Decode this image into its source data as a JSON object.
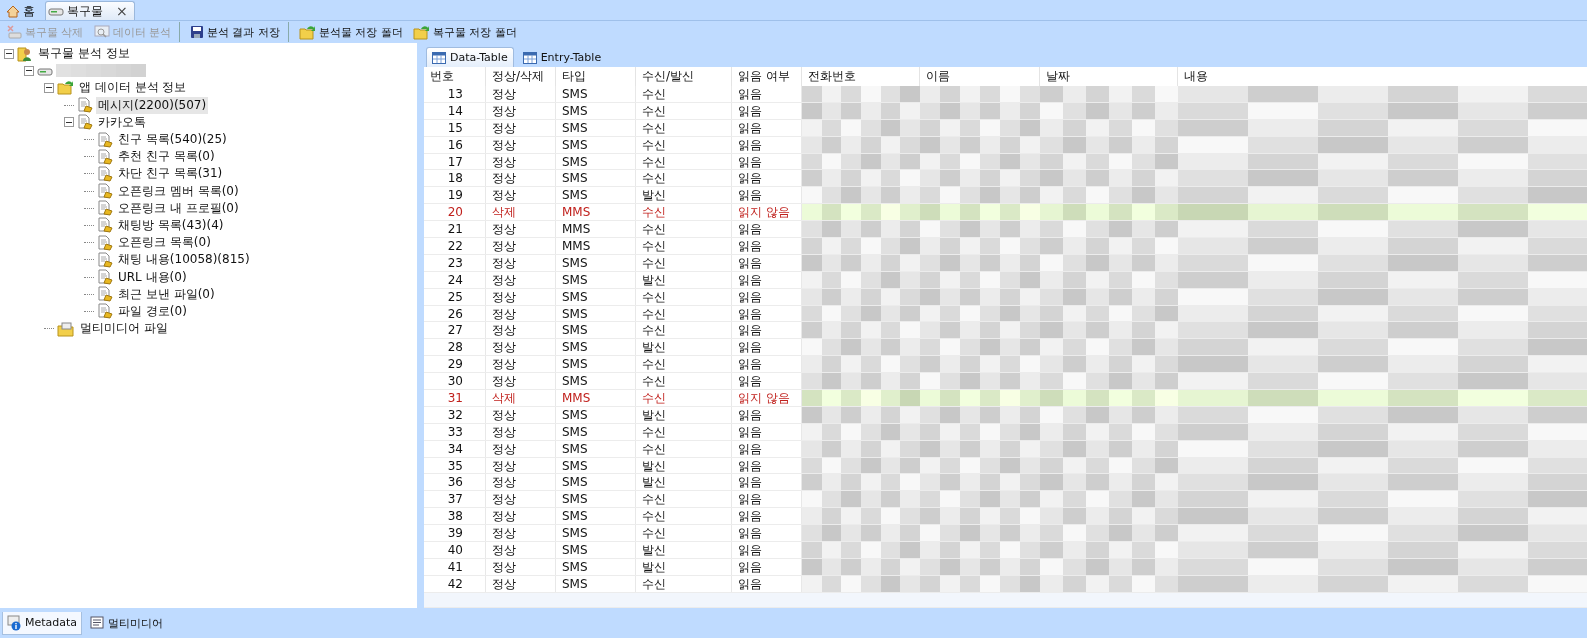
{
  "doc_tabs": [
    {
      "label": "홈",
      "selected": false,
      "closable": false
    },
    {
      "label": "복구물",
      "selected": true,
      "closable": true
    }
  ],
  "close_glyph": "×",
  "toolbar": [
    {
      "label": "복구물 삭제",
      "disabled": true,
      "separator_after": false
    },
    {
      "label": "데이터 분석",
      "disabled": true,
      "separator_after": true
    },
    {
      "label": "분석 결과 저장",
      "disabled": false,
      "separator_after": true
    },
    {
      "label": "분석물 저장 폴더",
      "disabled": false,
      "separator_after": false
    },
    {
      "label": "복구물 저장 폴더",
      "disabled": false,
      "separator_after": false
    }
  ],
  "tree": [
    {
      "label": "복구물 분석 정보",
      "kind": "root",
      "expanded": true,
      "selected": false,
      "children": [
        {
          "kind": "redacted",
          "expanded": true,
          "children": [
            {
              "label": "앱 데이터 분석 정보",
              "kind": "folder",
              "expanded": true,
              "selected": false,
              "children": [
                {
                  "label": "메시지(2200)(507)",
                  "kind": "document",
                  "selected": true
                },
                {
                  "label": "카카오톡",
                  "kind": "document",
                  "expanded": true,
                  "selected": false,
                  "children": [
                    {
                      "label": "친구 목록(540)(25)",
                      "kind": "document",
                      "selected": false
                    },
                    {
                      "label": "추천 친구 목록(0)",
                      "kind": "document",
                      "selected": false
                    },
                    {
                      "label": "차단 친구 목록(31)",
                      "kind": "document",
                      "selected": false
                    },
                    {
                      "label": "오픈링크 멤버 목록(0)",
                      "kind": "document",
                      "selected": false
                    },
                    {
                      "label": "오픈링크 내 프로필(0)",
                      "kind": "document",
                      "selected": false
                    },
                    {
                      "label": "채팅방 목록(43)(4)",
                      "kind": "document",
                      "selected": false
                    },
                    {
                      "label": "오픈링크 목록(0)",
                      "kind": "document",
                      "selected": false
                    },
                    {
                      "label": "채팅 내용(10058)(815)",
                      "kind": "document",
                      "selected": false
                    },
                    {
                      "label": "URL 내용(0)",
                      "kind": "document",
                      "selected": false
                    },
                    {
                      "label": "최근 보낸 파일(0)",
                      "kind": "document",
                      "selected": false
                    },
                    {
                      "label": "파일 경로(0)",
                      "kind": "document",
                      "selected": false
                    }
                  ]
                }
              ]
            },
            {
              "label": "멀티미디어 파일",
              "kind": "media",
              "selected": false
            }
          ]
        }
      ]
    }
  ],
  "table_tabs": [
    {
      "label": "Data-Table",
      "selected": true
    },
    {
      "label": "Entry-Table",
      "selected": false
    }
  ],
  "table": {
    "columns": [
      "번호",
      "정상/삭제",
      "타입",
      "수신/발신",
      "읽음 여부",
      "전화번호",
      "이름",
      "날짜",
      "내용"
    ],
    "rows": [
      {
        "no": "13",
        "status": "정상",
        "type": "SMS",
        "direction": "수신",
        "read": "읽음",
        "deleted": false
      },
      {
        "no": "14",
        "status": "정상",
        "type": "SMS",
        "direction": "수신",
        "read": "읽음",
        "deleted": false
      },
      {
        "no": "15",
        "status": "정상",
        "type": "SMS",
        "direction": "수신",
        "read": "읽음",
        "deleted": false
      },
      {
        "no": "16",
        "status": "정상",
        "type": "SMS",
        "direction": "수신",
        "read": "읽음",
        "deleted": false
      },
      {
        "no": "17",
        "status": "정상",
        "type": "SMS",
        "direction": "수신",
        "read": "읽음",
        "deleted": false
      },
      {
        "no": "18",
        "status": "정상",
        "type": "SMS",
        "direction": "수신",
        "read": "읽음",
        "deleted": false
      },
      {
        "no": "19",
        "status": "정상",
        "type": "SMS",
        "direction": "발신",
        "read": "읽음",
        "deleted": false
      },
      {
        "no": "20",
        "status": "삭제",
        "type": "MMS",
        "direction": "수신",
        "read": "읽지 않음",
        "deleted": true
      },
      {
        "no": "21",
        "status": "정상",
        "type": "MMS",
        "direction": "수신",
        "read": "읽음",
        "deleted": false
      },
      {
        "no": "22",
        "status": "정상",
        "type": "MMS",
        "direction": "수신",
        "read": "읽음",
        "deleted": false
      },
      {
        "no": "23",
        "status": "정상",
        "type": "SMS",
        "direction": "수신",
        "read": "읽음",
        "deleted": false
      },
      {
        "no": "24",
        "status": "정상",
        "type": "SMS",
        "direction": "발신",
        "read": "읽음",
        "deleted": false
      },
      {
        "no": "25",
        "status": "정상",
        "type": "SMS",
        "direction": "수신",
        "read": "읽음",
        "deleted": false
      },
      {
        "no": "26",
        "status": "정상",
        "type": "SMS",
        "direction": "수신",
        "read": "읽음",
        "deleted": false
      },
      {
        "no": "27",
        "status": "정상",
        "type": "SMS",
        "direction": "수신",
        "read": "읽음",
        "deleted": false
      },
      {
        "no": "28",
        "status": "정상",
        "type": "SMS",
        "direction": "발신",
        "read": "읽음",
        "deleted": false
      },
      {
        "no": "29",
        "status": "정상",
        "type": "SMS",
        "direction": "수신",
        "read": "읽음",
        "deleted": false
      },
      {
        "no": "30",
        "status": "정상",
        "type": "SMS",
        "direction": "수신",
        "read": "읽음",
        "deleted": false
      },
      {
        "no": "31",
        "status": "삭제",
        "type": "MMS",
        "direction": "수신",
        "read": "읽지 않음",
        "deleted": true
      },
      {
        "no": "32",
        "status": "정상",
        "type": "SMS",
        "direction": "발신",
        "read": "읽음",
        "deleted": false
      },
      {
        "no": "33",
        "status": "정상",
        "type": "SMS",
        "direction": "수신",
        "read": "읽음",
        "deleted": false
      },
      {
        "no": "34",
        "status": "정상",
        "type": "SMS",
        "direction": "수신",
        "read": "읽음",
        "deleted": false
      },
      {
        "no": "35",
        "status": "정상",
        "type": "SMS",
        "direction": "발신",
        "read": "읽음",
        "deleted": false
      },
      {
        "no": "36",
        "status": "정상",
        "type": "SMS",
        "direction": "발신",
        "read": "읽음",
        "deleted": false
      },
      {
        "no": "37",
        "status": "정상",
        "type": "SMS",
        "direction": "수신",
        "read": "읽음",
        "deleted": false
      },
      {
        "no": "38",
        "status": "정상",
        "type": "SMS",
        "direction": "수신",
        "read": "읽음",
        "deleted": false
      },
      {
        "no": "39",
        "status": "정상",
        "type": "SMS",
        "direction": "수신",
        "read": "읽음",
        "deleted": false
      },
      {
        "no": "40",
        "status": "정상",
        "type": "SMS",
        "direction": "발신",
        "read": "읽음",
        "deleted": false
      },
      {
        "no": "41",
        "status": "정상",
        "type": "SMS",
        "direction": "발신",
        "read": "읽음",
        "deleted": false
      },
      {
        "no": "42",
        "status": "정상",
        "type": "SMS",
        "direction": "수신",
        "read": "읽음",
        "deleted": false
      }
    ]
  },
  "bottom_tabs": [
    {
      "label": "Metadata",
      "selected": true
    },
    {
      "label": "멀티미디어",
      "selected": false
    }
  ]
}
